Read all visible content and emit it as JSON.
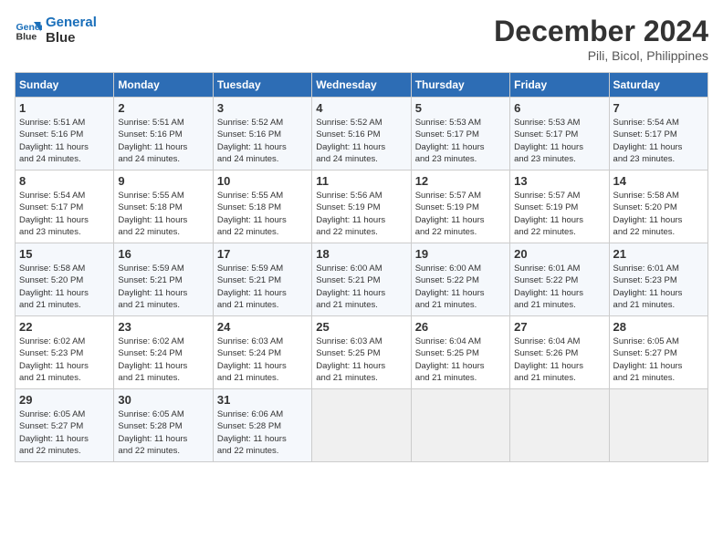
{
  "header": {
    "logo_line1": "General",
    "logo_line2": "Blue",
    "month": "December 2024",
    "location": "Pili, Bicol, Philippines"
  },
  "days_of_week": [
    "Sunday",
    "Monday",
    "Tuesday",
    "Wednesday",
    "Thursday",
    "Friday",
    "Saturday"
  ],
  "weeks": [
    [
      {
        "day": "1",
        "detail": "Sunrise: 5:51 AM\nSunset: 5:16 PM\nDaylight: 11 hours\nand 24 minutes."
      },
      {
        "day": "2",
        "detail": "Sunrise: 5:51 AM\nSunset: 5:16 PM\nDaylight: 11 hours\nand 24 minutes."
      },
      {
        "day": "3",
        "detail": "Sunrise: 5:52 AM\nSunset: 5:16 PM\nDaylight: 11 hours\nand 24 minutes."
      },
      {
        "day": "4",
        "detail": "Sunrise: 5:52 AM\nSunset: 5:16 PM\nDaylight: 11 hours\nand 24 minutes."
      },
      {
        "day": "5",
        "detail": "Sunrise: 5:53 AM\nSunset: 5:17 PM\nDaylight: 11 hours\nand 23 minutes."
      },
      {
        "day": "6",
        "detail": "Sunrise: 5:53 AM\nSunset: 5:17 PM\nDaylight: 11 hours\nand 23 minutes."
      },
      {
        "day": "7",
        "detail": "Sunrise: 5:54 AM\nSunset: 5:17 PM\nDaylight: 11 hours\nand 23 minutes."
      }
    ],
    [
      {
        "day": "8",
        "detail": "Sunrise: 5:54 AM\nSunset: 5:17 PM\nDaylight: 11 hours\nand 23 minutes."
      },
      {
        "day": "9",
        "detail": "Sunrise: 5:55 AM\nSunset: 5:18 PM\nDaylight: 11 hours\nand 22 minutes."
      },
      {
        "day": "10",
        "detail": "Sunrise: 5:55 AM\nSunset: 5:18 PM\nDaylight: 11 hours\nand 22 minutes."
      },
      {
        "day": "11",
        "detail": "Sunrise: 5:56 AM\nSunset: 5:19 PM\nDaylight: 11 hours\nand 22 minutes."
      },
      {
        "day": "12",
        "detail": "Sunrise: 5:57 AM\nSunset: 5:19 PM\nDaylight: 11 hours\nand 22 minutes."
      },
      {
        "day": "13",
        "detail": "Sunrise: 5:57 AM\nSunset: 5:19 PM\nDaylight: 11 hours\nand 22 minutes."
      },
      {
        "day": "14",
        "detail": "Sunrise: 5:58 AM\nSunset: 5:20 PM\nDaylight: 11 hours\nand 22 minutes."
      }
    ],
    [
      {
        "day": "15",
        "detail": "Sunrise: 5:58 AM\nSunset: 5:20 PM\nDaylight: 11 hours\nand 21 minutes."
      },
      {
        "day": "16",
        "detail": "Sunrise: 5:59 AM\nSunset: 5:21 PM\nDaylight: 11 hours\nand 21 minutes."
      },
      {
        "day": "17",
        "detail": "Sunrise: 5:59 AM\nSunset: 5:21 PM\nDaylight: 11 hours\nand 21 minutes."
      },
      {
        "day": "18",
        "detail": "Sunrise: 6:00 AM\nSunset: 5:21 PM\nDaylight: 11 hours\nand 21 minutes."
      },
      {
        "day": "19",
        "detail": "Sunrise: 6:00 AM\nSunset: 5:22 PM\nDaylight: 11 hours\nand 21 minutes."
      },
      {
        "day": "20",
        "detail": "Sunrise: 6:01 AM\nSunset: 5:22 PM\nDaylight: 11 hours\nand 21 minutes."
      },
      {
        "day": "21",
        "detail": "Sunrise: 6:01 AM\nSunset: 5:23 PM\nDaylight: 11 hours\nand 21 minutes."
      }
    ],
    [
      {
        "day": "22",
        "detail": "Sunrise: 6:02 AM\nSunset: 5:23 PM\nDaylight: 11 hours\nand 21 minutes."
      },
      {
        "day": "23",
        "detail": "Sunrise: 6:02 AM\nSunset: 5:24 PM\nDaylight: 11 hours\nand 21 minutes."
      },
      {
        "day": "24",
        "detail": "Sunrise: 6:03 AM\nSunset: 5:24 PM\nDaylight: 11 hours\nand 21 minutes."
      },
      {
        "day": "25",
        "detail": "Sunrise: 6:03 AM\nSunset: 5:25 PM\nDaylight: 11 hours\nand 21 minutes."
      },
      {
        "day": "26",
        "detail": "Sunrise: 6:04 AM\nSunset: 5:25 PM\nDaylight: 11 hours\nand 21 minutes."
      },
      {
        "day": "27",
        "detail": "Sunrise: 6:04 AM\nSunset: 5:26 PM\nDaylight: 11 hours\nand 21 minutes."
      },
      {
        "day": "28",
        "detail": "Sunrise: 6:05 AM\nSunset: 5:27 PM\nDaylight: 11 hours\nand 21 minutes."
      }
    ],
    [
      {
        "day": "29",
        "detail": "Sunrise: 6:05 AM\nSunset: 5:27 PM\nDaylight: 11 hours\nand 22 minutes."
      },
      {
        "day": "30",
        "detail": "Sunrise: 6:05 AM\nSunset: 5:28 PM\nDaylight: 11 hours\nand 22 minutes."
      },
      {
        "day": "31",
        "detail": "Sunrise: 6:06 AM\nSunset: 5:28 PM\nDaylight: 11 hours\nand 22 minutes."
      },
      {
        "day": "",
        "detail": ""
      },
      {
        "day": "",
        "detail": ""
      },
      {
        "day": "",
        "detail": ""
      },
      {
        "day": "",
        "detail": ""
      }
    ]
  ]
}
